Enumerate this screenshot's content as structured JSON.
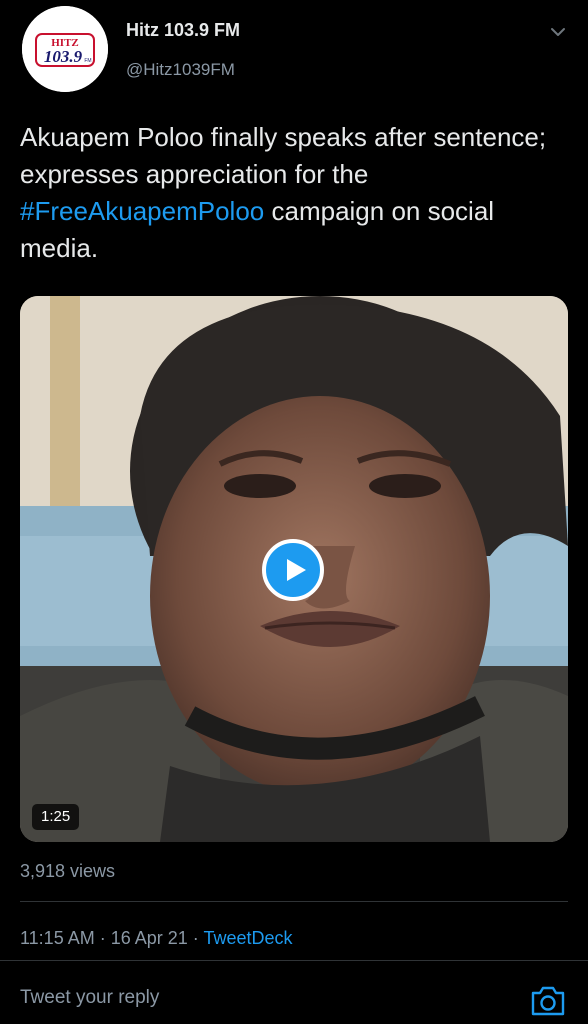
{
  "account": {
    "display_name": "Hitz 103.9 FM",
    "handle": "@Hitz1039FM",
    "avatar_logo_text": "HITZ 103.9",
    "avatar_logo_subtext": "FM"
  },
  "tweet": {
    "text_before": "Akuapem Poloo finally speaks after sentence; expresses appreciation for the ",
    "hashtag": "#FreeAkuapemPoloo",
    "text_after": " campaign on social media."
  },
  "video": {
    "duration": "1:25"
  },
  "stats": {
    "views": "3,918 views"
  },
  "meta": {
    "time": "11:15 AM",
    "separator": " · ",
    "date": "16 Apr 21",
    "source": "TweetDeck"
  },
  "reply": {
    "placeholder": "Tweet your reply"
  },
  "colors": {
    "background": "#000000",
    "accent": "#1d9bf0",
    "text": "#e7e9ea",
    "muted": "#8b98a5"
  },
  "icons": {
    "more": "chevron-down-icon",
    "play": "play-icon",
    "camera": "camera-icon"
  }
}
